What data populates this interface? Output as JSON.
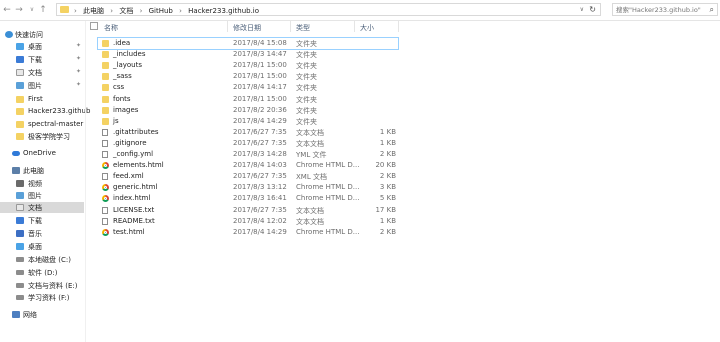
{
  "nav_buttons": {
    "back": "←",
    "forward": "→",
    "recent": "∨",
    "up": "↑"
  },
  "breadcrumb": [
    "此电脑",
    "文档",
    "GitHub",
    "Hacker233.github.io"
  ],
  "breadcrumb_separator": "›",
  "search": {
    "placeholder": "搜索\"Hacker233.github.io\""
  },
  "sidebar": {
    "quick_access": "快速访问",
    "pinned": [
      {
        "label": "桌面",
        "icon": "desktop-icon"
      },
      {
        "label": "下载",
        "icon": "download-icon"
      },
      {
        "label": "文档",
        "icon": "document-icon"
      },
      {
        "label": "图片",
        "icon": "picture-icon"
      }
    ],
    "recent": [
      "First",
      "Hacker233.github",
      "spectral-master",
      "极客学院学习"
    ],
    "onedrive": "OneDrive",
    "this_pc": "此电脑",
    "pc_items": [
      "视频",
      "图片",
      "文档",
      "下载",
      "音乐",
      "桌面"
    ],
    "drives": [
      "本地磁盘 (C:)",
      "软件 (D:)",
      "文档与资料 (E:)",
      "学习资料 (F:)"
    ],
    "network": "网络"
  },
  "columns": {
    "name": "名称",
    "date": "修改日期",
    "type": "类型",
    "size": "大小"
  },
  "files": [
    {
      "name": ".idea",
      "date": "2017/8/4 15:08",
      "type": "文件夹",
      "size": "",
      "icon": "folder"
    },
    {
      "name": "_includes",
      "date": "2017/8/3 14:47",
      "type": "文件夹",
      "size": "",
      "icon": "folder"
    },
    {
      "name": "_layouts",
      "date": "2017/8/1 15:00",
      "type": "文件夹",
      "size": "",
      "icon": "folder"
    },
    {
      "name": "_sass",
      "date": "2017/8/1 15:00",
      "type": "文件夹",
      "size": "",
      "icon": "folder"
    },
    {
      "name": "css",
      "date": "2017/8/4 14:17",
      "type": "文件夹",
      "size": "",
      "icon": "folder"
    },
    {
      "name": "fonts",
      "date": "2017/8/1 15:00",
      "type": "文件夹",
      "size": "",
      "icon": "folder"
    },
    {
      "name": "images",
      "date": "2017/8/2 20:36",
      "type": "文件夹",
      "size": "",
      "icon": "folder"
    },
    {
      "name": "js",
      "date": "2017/8/4 14:29",
      "type": "文件夹",
      "size": "",
      "icon": "folder"
    },
    {
      "name": ".gitattributes",
      "date": "2017/6/27 7:35",
      "type": "文本文档",
      "size": "1 KB",
      "icon": "file"
    },
    {
      "name": ".gitignore",
      "date": "2017/6/27 7:35",
      "type": "文本文档",
      "size": "1 KB",
      "icon": "file"
    },
    {
      "name": "_config.yml",
      "date": "2017/8/3 14:28",
      "type": "YML 文件",
      "size": "2 KB",
      "icon": "file"
    },
    {
      "name": "elements.html",
      "date": "2017/8/4 14:03",
      "type": "Chrome HTML D...",
      "size": "20 KB",
      "icon": "chrome"
    },
    {
      "name": "feed.xml",
      "date": "2017/6/27 7:35",
      "type": "XML 文档",
      "size": "2 KB",
      "icon": "file"
    },
    {
      "name": "generic.html",
      "date": "2017/8/3 13:12",
      "type": "Chrome HTML D...",
      "size": "3 KB",
      "icon": "chrome"
    },
    {
      "name": "index.html",
      "date": "2017/8/3 16:41",
      "type": "Chrome HTML D...",
      "size": "5 KB",
      "icon": "chrome"
    },
    {
      "name": "LICENSE.txt",
      "date": "2017/6/27 7:35",
      "type": "文本文档",
      "size": "17 KB",
      "icon": "file"
    },
    {
      "name": "README.txt",
      "date": "2017/8/4 12:02",
      "type": "文本文档",
      "size": "1 KB",
      "icon": "file"
    },
    {
      "name": "test.html",
      "date": "2017/8/4 14:29",
      "type": "Chrome HTML D...",
      "size": "2 KB",
      "icon": "chrome"
    }
  ]
}
